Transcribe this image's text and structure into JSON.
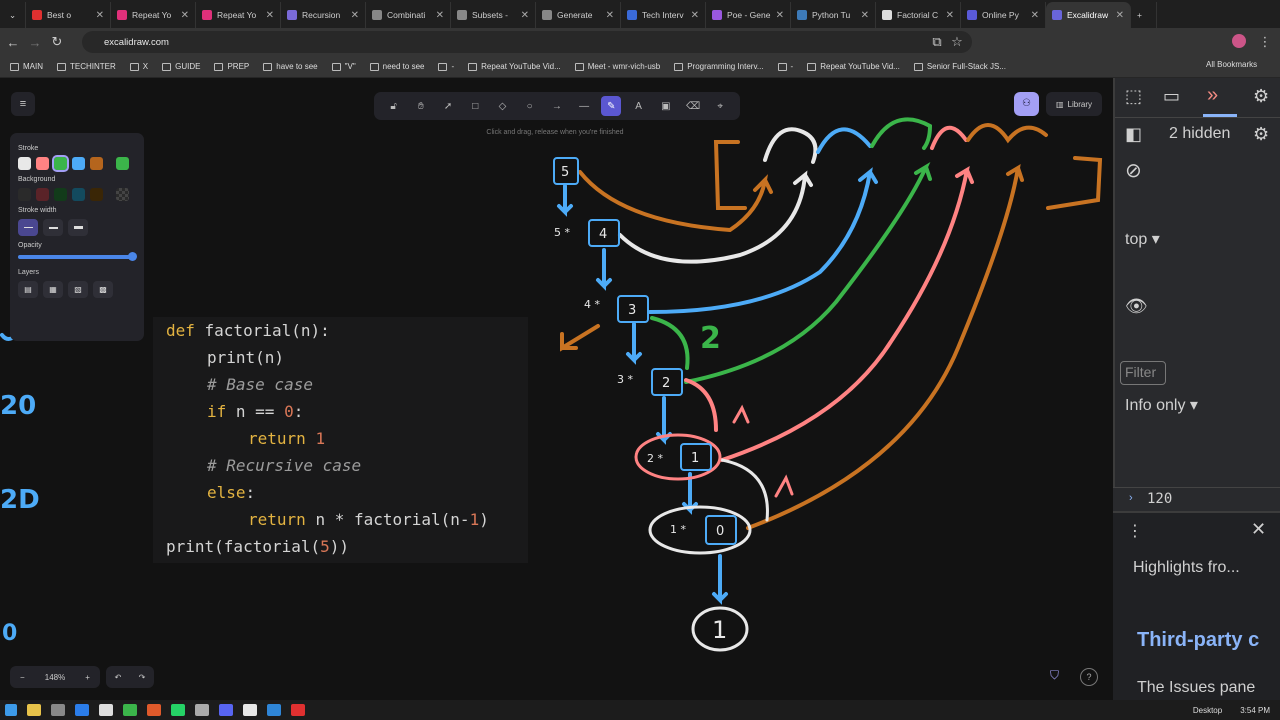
{
  "browser": {
    "tabs": [
      {
        "label": "Best o",
        "color": "#e03030"
      },
      {
        "label": "Repeat Yo",
        "color": "#e0307a"
      },
      {
        "label": "Repeat Yo",
        "color": "#e0307a"
      },
      {
        "label": "Recursion",
        "color": "#7a6ad8"
      },
      {
        "label": "Combinati",
        "color": "#888888"
      },
      {
        "label": "Subsets -",
        "color": "#888888"
      },
      {
        "label": "Generate",
        "color": "#888888"
      },
      {
        "label": "Tech Interv",
        "color": "#3a6ad8"
      },
      {
        "label": "Poe - Gene",
        "color": "#9a58e0"
      },
      {
        "label": "Python Tu",
        "color": "#3d7ab8"
      },
      {
        "label": "Factorial C",
        "color": "#dddddd"
      },
      {
        "label": "Online Py",
        "color": "#5a5ad8"
      },
      {
        "label": "Excalidraw",
        "color": "#6965db"
      }
    ],
    "url": "excalidraw.com",
    "bookmarks": [
      "MAIN",
      "TECHINTER",
      "X",
      "GUIDE",
      "PREP",
      "have to see",
      "\"V\"",
      "need to see",
      "-",
      "Repeat YouTube Vid...",
      "Meet - wmr-vich-usb",
      "Programming Interv...",
      "-",
      "Repeat YouTube Vid...",
      "Senior Full-Stack JS..."
    ],
    "all_bookmarks": "All Bookmarks"
  },
  "excalidraw": {
    "hint": "Click and drag, release when you're finished",
    "library_label": "Library",
    "properties": {
      "stroke_label": "Stroke",
      "stroke_colors": [
        "#e8e8e8",
        "#ff8383",
        "#3bb54a",
        "#4dabf7",
        "#b5651d"
      ],
      "stroke_current": "#3bb54a",
      "background_label": "Background",
      "background_colors": [
        "#2a2a2a",
        "#5a2328",
        "#123b1a",
        "#134a5e",
        "#3a2606"
      ],
      "stroke_width_label": "Stroke width",
      "opacity_label": "Opacity",
      "opacity_value": 100,
      "layers_label": "Layers"
    },
    "code": [
      {
        "indent": 0,
        "parts": [
          [
            "kw",
            "def "
          ],
          [
            "tx",
            "factorial(n):"
          ]
        ]
      },
      {
        "indent": 1,
        "parts": [
          [
            "tx",
            "print(n)"
          ]
        ]
      },
      {
        "indent": 1,
        "parts": [
          [
            "cm",
            "# Base case"
          ]
        ]
      },
      {
        "indent": 1,
        "parts": [
          [
            "kw",
            "if "
          ],
          [
            "tx",
            "n == "
          ],
          [
            "num",
            "0"
          ],
          [
            "tx",
            ":"
          ]
        ]
      },
      {
        "indent": 2,
        "parts": [
          [
            "kw",
            "return "
          ],
          [
            "num",
            "1"
          ]
        ]
      },
      {
        "indent": 1,
        "parts": [
          [
            "cm",
            "# Recursive case"
          ]
        ]
      },
      {
        "indent": 1,
        "parts": [
          [
            "kw",
            "else"
          ],
          [
            "tx",
            ":"
          ]
        ]
      },
      {
        "indent": 2,
        "parts": [
          [
            "kw",
            "return "
          ],
          [
            "tx",
            "n * factorial(n-"
          ],
          [
            "num",
            "1"
          ],
          [
            "tx",
            ")"
          ]
        ]
      },
      {
        "indent": 0,
        "parts": [
          [
            "tx",
            "print(factorial("
          ],
          [
            "num",
            "5"
          ],
          [
            "tx",
            "))"
          ]
        ]
      }
    ],
    "diagram": {
      "boxes": [
        "5",
        "4",
        "3",
        "2",
        "1",
        "0"
      ],
      "prefixes": [
        "5 *",
        "4 *",
        "3 *",
        "2 *",
        "1 *"
      ],
      "result": "1",
      "marks": [
        "2",
        "1",
        "1"
      ]
    },
    "zoom": "148%"
  },
  "devtools": {
    "hidden": "2 hidden",
    "context": "top",
    "filter_placeholder": "Filter",
    "level": "Info only",
    "console_value": "120",
    "drawer_title": "Highlights fro...",
    "drawer_heading": "Third-party c",
    "drawer_text": "The Issues pane"
  },
  "taskbar": {
    "desktop": "Desktop",
    "time": "3:54 PM"
  }
}
